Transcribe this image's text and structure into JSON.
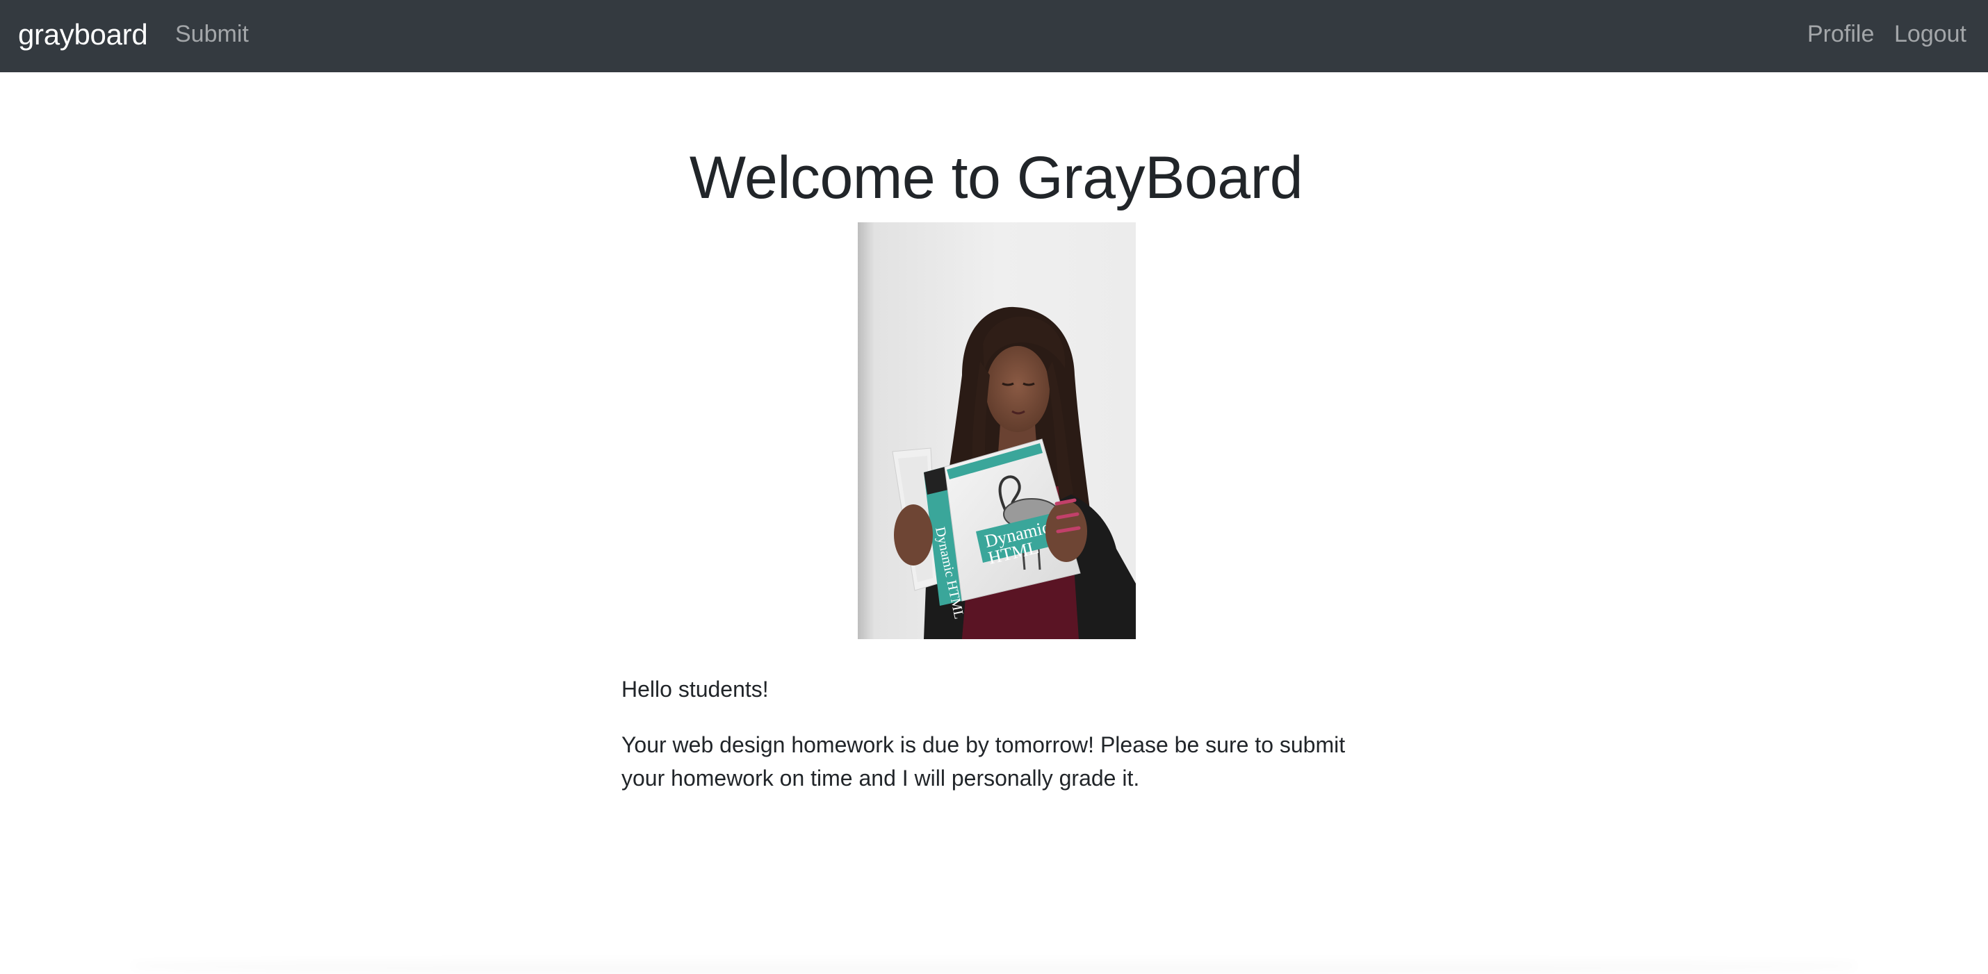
{
  "navbar": {
    "brand": "grayboard",
    "links": {
      "submit": "Submit",
      "profile": "Profile",
      "logout": "Logout"
    },
    "background_color": "#343a40"
  },
  "main": {
    "title": "Welcome to GrayBoard",
    "image": {
      "semantic": "photo of a woman reading a Dynamic HTML book",
      "book_title": "Dynamic HTML"
    },
    "paragraphs": [
      "Hello students!",
      "Your web design homework is due by tomorrow! Please be sure to submit your homework on time and I will personally grade it."
    ]
  }
}
